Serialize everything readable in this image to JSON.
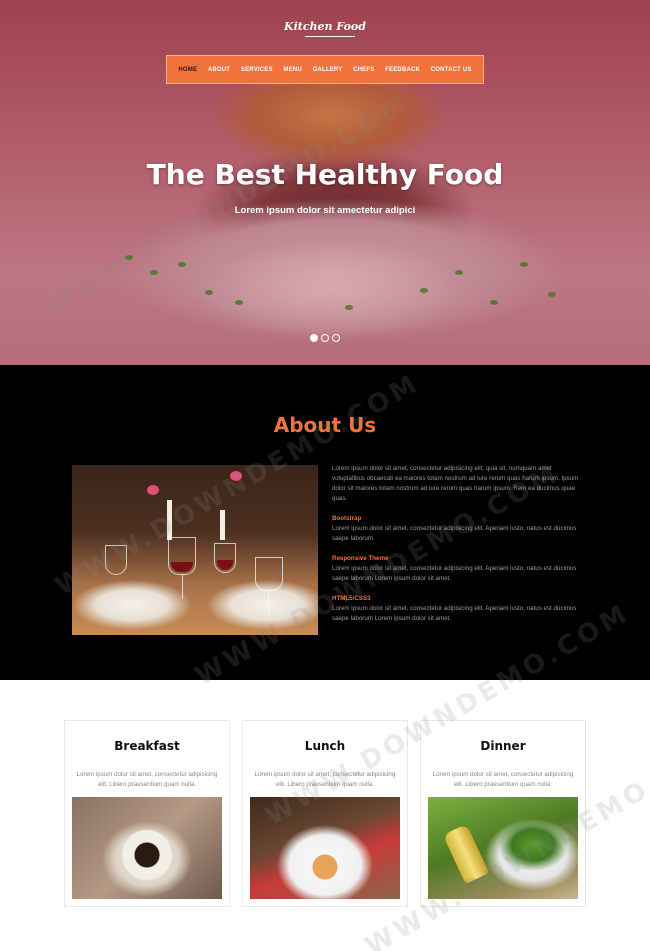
{
  "brand": {
    "logo": "Kitchen Food"
  },
  "nav": {
    "items": [
      "HOME",
      "ABOUT",
      "SERVICES",
      "MENU",
      "GALLERY",
      "CHEFS",
      "FEEDBACK",
      "CONTACT US"
    ],
    "active": "HOME"
  },
  "hero": {
    "title": "The Best Healthy Food",
    "subtitle": "Lorem ipsum dolor sit amectetur adipici",
    "slides_count": 3,
    "active_slide": 1
  },
  "about": {
    "title": "About Us",
    "intro": "Lorem ipsum dolor sit amet, consectetur adipisicing elit, quia sit, numquam amet voluptatibus obcaecati ea maiores totam nostrum ad iure rerum quas harum ipsum. Ipsum dolor sit maiores totam nostrum ad iure rerum quas harum ipsum. Rem ea ducimus quae quas.",
    "sections": [
      {
        "heading": "Bootstrap",
        "text": "Lorem ipsum dolor sit amet, consectetur adipisicing elit. Aperiam iusto, natus est ducimus saepe laborum."
      },
      {
        "heading": "Responsive Theme",
        "text": "Lorem ipsum dolor sit amet, consectetur adipisicing elit. Aperiam iusto, natus est ducimus saepe laborum Lorem ipsum dolor sit amet."
      },
      {
        "heading": "HTML5/CSS3",
        "text": "Lorem ipsum dolor sit amet, consectetur adipisicing elit. Aperiam iusto, natus est ducimus saepe laborum Lorem ipsum dolor sit amet."
      }
    ]
  },
  "meals": [
    {
      "title": "Breakfast",
      "text": "Lorem ipsum dolor sit amet, consectetur adipisicing elit. Libero praesentium quam nulla."
    },
    {
      "title": "Lunch",
      "text": "Lorem ipsum dolor sit amet, consectetur adipisicing elit. Libero praesentium quam nulla."
    },
    {
      "title": "Dinner",
      "text": "Lorem ipsum dolor sit amet, consectetur adipisicing elit. Libero praesentium quam nulla."
    }
  ],
  "watermark": "WWW.DOWNDEMO.COM",
  "colors": {
    "accent": "#f1723a",
    "dark": "#000000"
  }
}
